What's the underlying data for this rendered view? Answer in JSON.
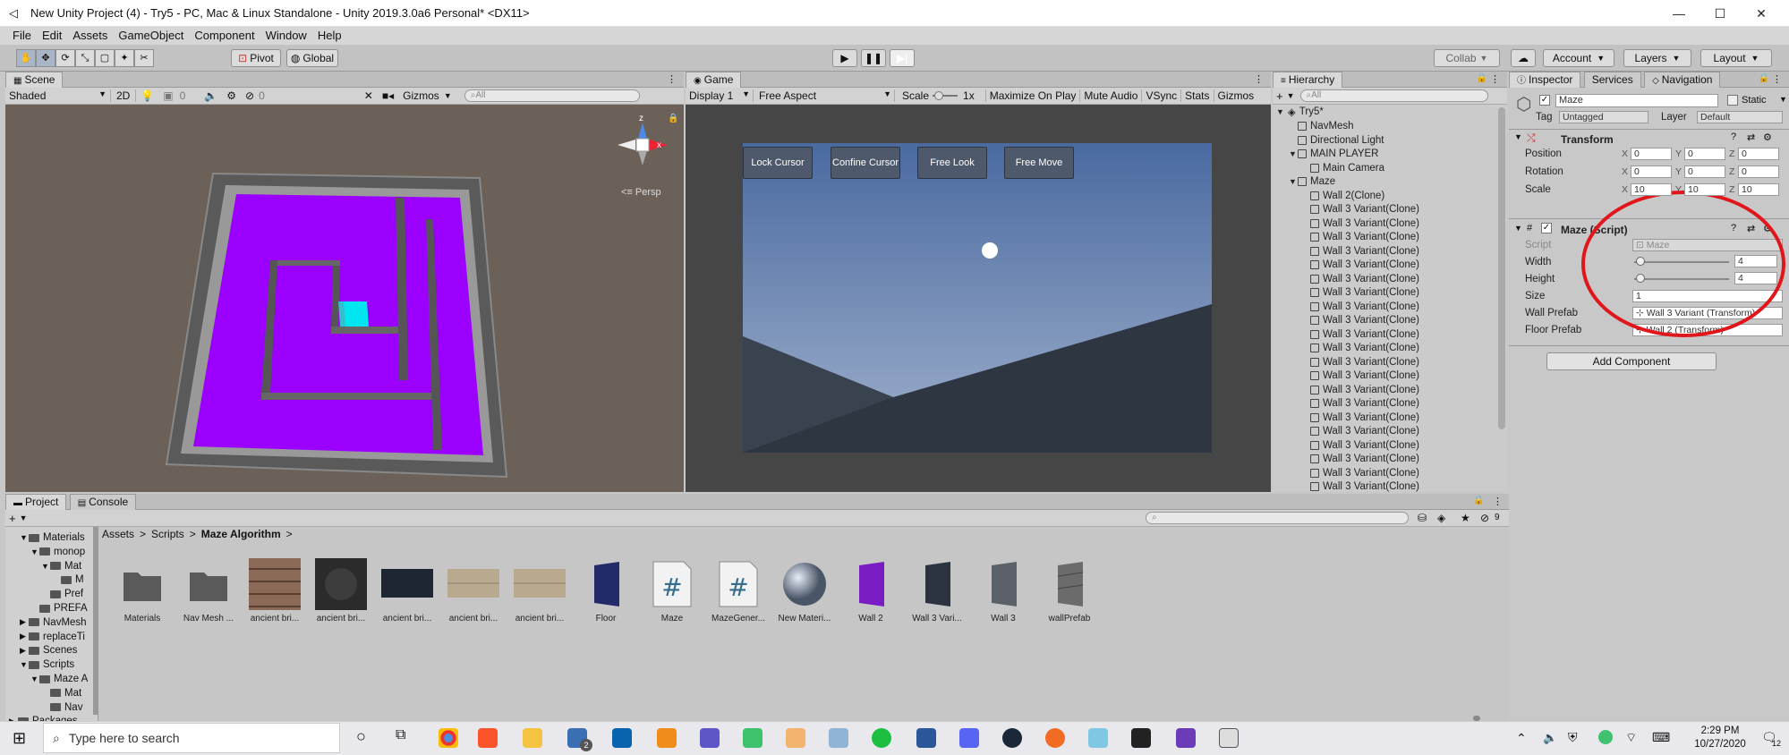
{
  "window": {
    "title": "New Unity Project (4) - Try5 - PC, Mac & Linux Standalone - Unity 2019.3.0a6 Personal* <DX11>"
  },
  "menu": [
    "File",
    "Edit",
    "Assets",
    "GameObject",
    "Component",
    "Window",
    "Help"
  ],
  "toolbar": {
    "pivot": "Pivot",
    "global": "Global",
    "collab": "Collab",
    "account": "Account",
    "layers": "Layers",
    "layout": "Layout"
  },
  "scene": {
    "tab": "Scene",
    "shading": "Shaded",
    "mode2d": "2D",
    "fx_count": "0",
    "hidden_count": "0",
    "gizmos": "Gizmos",
    "search_placeholder": "All",
    "persp": "Persp",
    "axis_x": "x",
    "axis_z": "z"
  },
  "game": {
    "tab": "Game",
    "display": "Display 1",
    "aspect": "Free Aspect",
    "scale_label": "Scale",
    "scale_value": "1x",
    "toggles": [
      "Maximize On Play",
      "Mute Audio",
      "VSync",
      "Stats",
      "Gizmos"
    ],
    "buttons": [
      "Lock Cursor",
      "Confine Cursor",
      "Free Look",
      "Free Move"
    ]
  },
  "hierarchy": {
    "tab": "Hierarchy",
    "search_placeholder": "All",
    "scene_name": "Try5*",
    "items": [
      {
        "label": "NavMesh",
        "indent": 1,
        "arrow": ""
      },
      {
        "label": "Directional Light",
        "indent": 1,
        "arrow": ""
      },
      {
        "label": "MAIN PLAYER",
        "indent": 1,
        "arrow": "▼"
      },
      {
        "label": "Main Camera",
        "indent": 2,
        "arrow": ""
      },
      {
        "label": "Maze",
        "indent": 1,
        "arrow": "▼"
      },
      {
        "label": "Wall 2(Clone)",
        "indent": 2,
        "arrow": ""
      },
      {
        "label": "Wall 3 Variant(Clone)",
        "indent": 2,
        "arrow": ""
      },
      {
        "label": "Wall 3 Variant(Clone)",
        "indent": 2,
        "arrow": ""
      },
      {
        "label": "Wall 3 Variant(Clone)",
        "indent": 2,
        "arrow": ""
      },
      {
        "label": "Wall 3 Variant(Clone)",
        "indent": 2,
        "arrow": ""
      },
      {
        "label": "Wall 3 Variant(Clone)",
        "indent": 2,
        "arrow": ""
      },
      {
        "label": "Wall 3 Variant(Clone)",
        "indent": 2,
        "arrow": ""
      },
      {
        "label": "Wall 3 Variant(Clone)",
        "indent": 2,
        "arrow": ""
      },
      {
        "label": "Wall 3 Variant(Clone)",
        "indent": 2,
        "arrow": ""
      },
      {
        "label": "Wall 3 Variant(Clone)",
        "indent": 2,
        "arrow": ""
      },
      {
        "label": "Wall 3 Variant(Clone)",
        "indent": 2,
        "arrow": ""
      },
      {
        "label": "Wall 3 Variant(Clone)",
        "indent": 2,
        "arrow": ""
      },
      {
        "label": "Wall 3 Variant(Clone)",
        "indent": 2,
        "arrow": ""
      },
      {
        "label": "Wall 3 Variant(Clone)",
        "indent": 2,
        "arrow": ""
      },
      {
        "label": "Wall 3 Variant(Clone)",
        "indent": 2,
        "arrow": ""
      },
      {
        "label": "Wall 3 Variant(Clone)",
        "indent": 2,
        "arrow": ""
      },
      {
        "label": "Wall 3 Variant(Clone)",
        "indent": 2,
        "arrow": ""
      },
      {
        "label": "Wall 3 Variant(Clone)",
        "indent": 2,
        "arrow": ""
      },
      {
        "label": "Wall 3 Variant(Clone)",
        "indent": 2,
        "arrow": ""
      },
      {
        "label": "Wall 3 Variant(Clone)",
        "indent": 2,
        "arrow": ""
      },
      {
        "label": "Wall 3 Variant(Clone)",
        "indent": 2,
        "arrow": ""
      },
      {
        "label": "Wall 3 Variant(Clone)",
        "indent": 2,
        "arrow": ""
      },
      {
        "label": "Wall 3 Variant(Clone)",
        "indent": 2,
        "arrow": ""
      }
    ]
  },
  "inspector": {
    "tabs": [
      "Inspector",
      "Services",
      "Navigation"
    ],
    "object_name": "Maze",
    "static_label": "Static",
    "tag_label": "Tag",
    "tag_value": "Untagged",
    "layer_label": "Layer",
    "layer_value": "Default",
    "transform": {
      "title": "Transform",
      "rows": [
        {
          "label": "Position",
          "x": "0",
          "y": "0",
          "z": "0"
        },
        {
          "label": "Rotation",
          "x": "0",
          "y": "0",
          "z": "0"
        },
        {
          "label": "Scale",
          "x": "10",
          "y": "10",
          "z": "10"
        }
      ]
    },
    "script": {
      "title": "Maze (Script)",
      "script_label": "Script",
      "script_value": "Maze",
      "width_label": "Width",
      "width_value": "4",
      "height_label": "Height",
      "height_value": "4",
      "size_label": "Size",
      "size_value": "1",
      "wall_label": "Wall Prefab",
      "wall_value": "Wall 3 Variant (Transform)",
      "floor_label": "Floor Prefab",
      "floor_value": "Wall 2 (Transform)"
    },
    "add_component": "Add Component",
    "highlight_color": "#e0161b"
  },
  "project": {
    "tabs": [
      "Project",
      "Console"
    ],
    "count": "9",
    "breadcrumb": [
      "Assets",
      "Scripts",
      "Maze Algorithm"
    ],
    "tree": [
      {
        "label": "Materials",
        "indent": 1,
        "arrow": "▼"
      },
      {
        "label": "monop",
        "indent": 2,
        "arrow": "▼"
      },
      {
        "label": "Mat",
        "indent": 3,
        "arrow": "▼"
      },
      {
        "label": "M",
        "indent": 4,
        "arrow": ""
      },
      {
        "label": "Pref",
        "indent": 3,
        "arrow": ""
      },
      {
        "label": "PREFA",
        "indent": 2,
        "arrow": ""
      },
      {
        "label": "NavMesh",
        "indent": 1,
        "arrow": "▶"
      },
      {
        "label": "replaceTi",
        "indent": 1,
        "arrow": "▶"
      },
      {
        "label": "Scenes",
        "indent": 1,
        "arrow": "▶"
      },
      {
        "label": "Scripts",
        "indent": 1,
        "arrow": "▼"
      },
      {
        "label": "Maze A",
        "indent": 2,
        "arrow": "▼"
      },
      {
        "label": "Mat",
        "indent": 3,
        "arrow": ""
      },
      {
        "label": "Nav",
        "indent": 3,
        "arrow": ""
      },
      {
        "label": "Packages",
        "indent": 0,
        "arrow": "▶"
      }
    ],
    "assets": [
      {
        "label": "Materials",
        "kind": "folder"
      },
      {
        "label": "Nav Mesh ...",
        "kind": "folder"
      },
      {
        "label": "ancient bri...",
        "kind": "brick"
      },
      {
        "label": "ancient bri...",
        "kind": "dark"
      },
      {
        "label": "ancient bri...",
        "kind": "navy"
      },
      {
        "label": "ancient bri...",
        "kind": "tan"
      },
      {
        "label": "ancient bri...",
        "kind": "tan"
      },
      {
        "label": "Floor",
        "kind": "navyprefab"
      },
      {
        "label": "Maze",
        "kind": "script"
      },
      {
        "label": "MazeGener...",
        "kind": "script"
      },
      {
        "label": "New Materi...",
        "kind": "sphere"
      },
      {
        "label": "Wall 2",
        "kind": "purpleprefab"
      },
      {
        "label": "Wall 3 Vari...",
        "kind": "darkprefab"
      },
      {
        "label": "Wall 3",
        "kind": "greyprefab"
      },
      {
        "label": "wallPrefab",
        "kind": "stoneprefab"
      }
    ]
  },
  "taskbar": {
    "search_placeholder": "Type here to search",
    "time": "2:29 PM",
    "date": "10/27/2020",
    "notif_count": "12",
    "mail_badge": "2"
  }
}
